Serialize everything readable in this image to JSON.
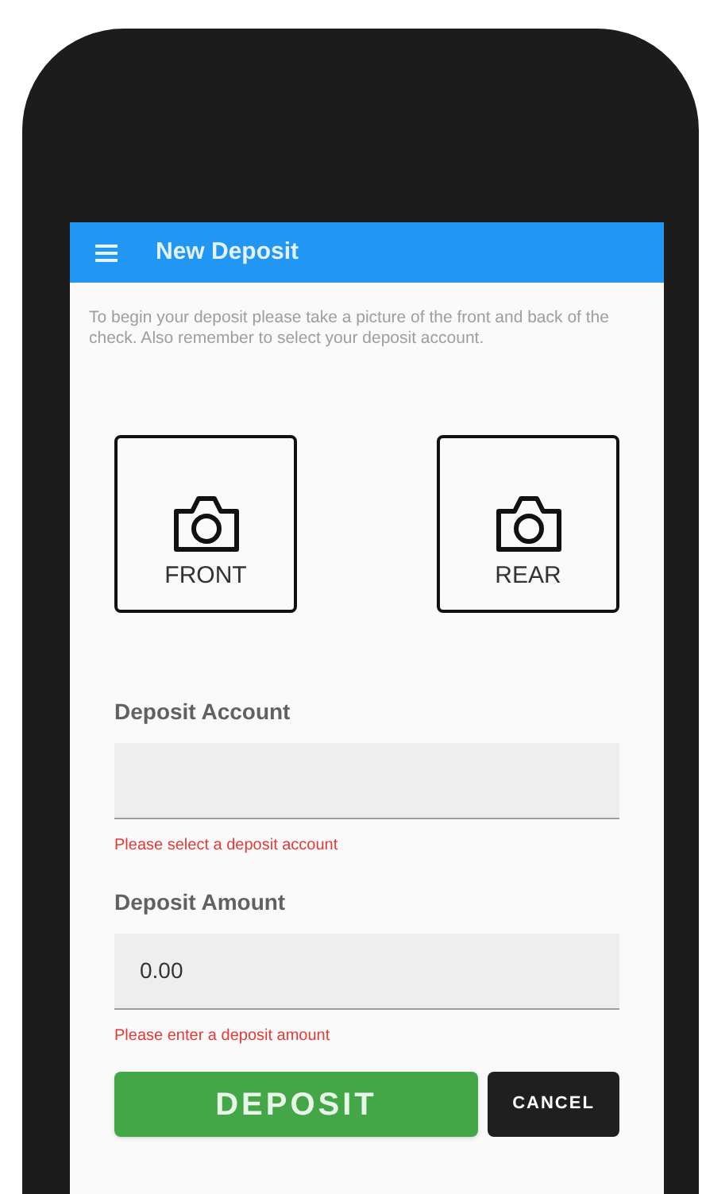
{
  "app_bar": {
    "title": "New Deposit"
  },
  "intro": "To begin your deposit please take a picture of the front and back of the check. Also remember to select your deposit account.",
  "photo_buttons": [
    {
      "label": "FRONT"
    },
    {
      "label": "REAR"
    }
  ],
  "fields": [
    {
      "label": "Deposit Account",
      "error": "Please select a deposit account"
    },
    {
      "label": "Deposit Amount",
      "value": "0.00",
      "error": "Please enter a deposit amount"
    }
  ],
  "buttons": [
    {
      "kind": "primary",
      "label": "DEPOSIT"
    },
    {
      "kind": "secondary",
      "label": "CANCEL"
    }
  ]
}
